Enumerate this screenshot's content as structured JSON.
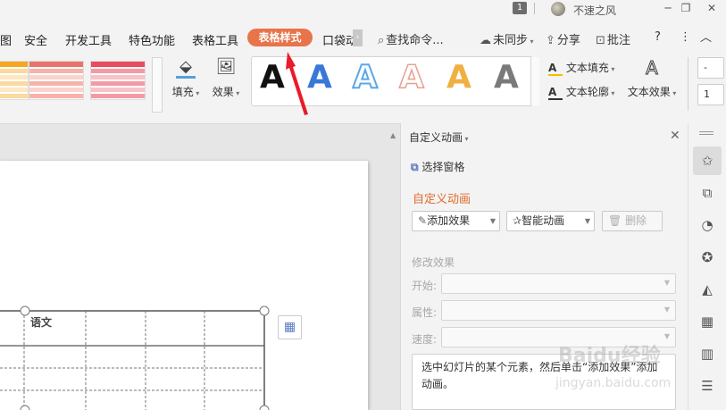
{
  "titlebar": {
    "badge": "1",
    "username": "不速之风",
    "min": "─",
    "restore": "❐",
    "close": "✕"
  },
  "tabs": [
    {
      "label": "图"
    },
    {
      "label": "安全"
    },
    {
      "label": "开发工具"
    },
    {
      "label": "特色功能"
    },
    {
      "label": "表格工具"
    },
    {
      "label": "表格样式"
    },
    {
      "label": "口袋动"
    }
  ],
  "search": {
    "label": "查找命令..."
  },
  "toolbar_right": {
    "sync": "未同步",
    "share": "分享",
    "comment": "批注",
    "help": "?",
    "more": "⋮",
    "collapse": "︿"
  },
  "ribbon": {
    "fill": "填充",
    "effect": "效果",
    "wordart_glyph": "A",
    "text_fill": "文本填充",
    "text_outline": "文本轮廓",
    "text_effect": "文本效果",
    "mini_input_1": "-",
    "mini_input_2": "1",
    "swatch_colors": [
      "#f5a623",
      "#e8746a",
      "#e84c5e"
    ],
    "wordart_colors": [
      "#111111",
      "#3a78d8",
      "#5aa7e8",
      "#e8a090",
      "#f0b040",
      "#7a7a7a"
    ]
  },
  "slide": {
    "cell_label": "语文"
  },
  "pane": {
    "title": "自定义动画",
    "select_window": "选择窗格",
    "heading": "自定义动画",
    "add_effect": "添加效果",
    "smart_anim": "智能动画",
    "delete": "删除",
    "modify": "修改效果",
    "start_label": "开始:",
    "property_label": "属性:",
    "speed_label": "速度:",
    "hint": "选中幻灯片的某个元素，然后单击“添加效果”添加动画。"
  },
  "watermark": {
    "line1": "Baidu经验",
    "line2": "jingyan.baidu.com"
  },
  "sidebar": {
    "icons": [
      "star-animation-icon",
      "transform-icon",
      "shapes-icon",
      "badge-icon",
      "layers-icon",
      "grid-icon",
      "bar-chart-icon",
      "sliders-icon"
    ]
  }
}
